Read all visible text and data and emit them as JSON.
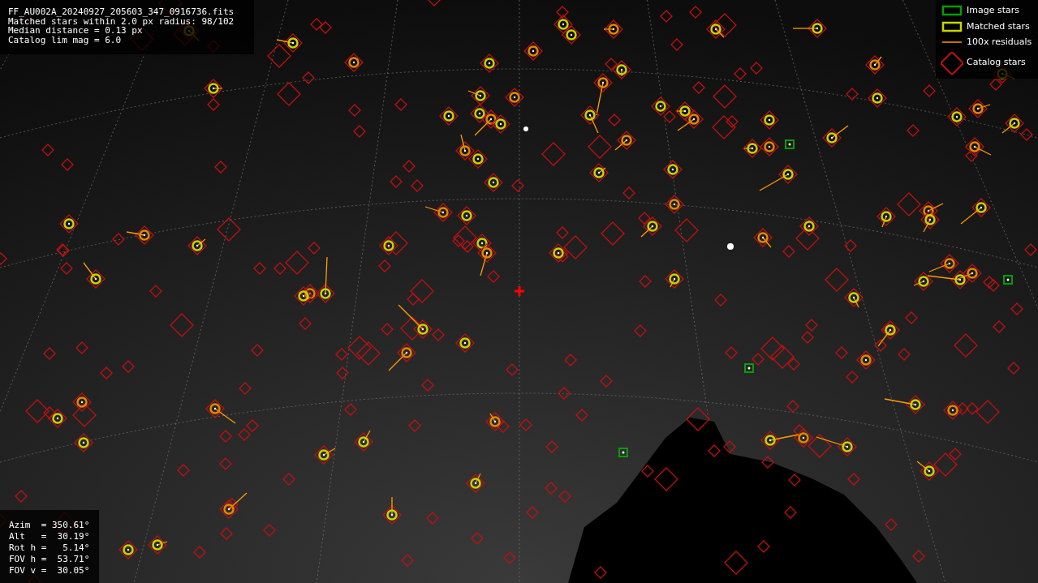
{
  "info_lines": [
    "FF_AU002A_20240927_205603_347_0916736.fits",
    "Matched stars within 2.0 px radius: 98/102",
    "Median distance = 0.13 px",
    "Catalog lim mag = 6.0"
  ],
  "legend": [
    {
      "kind": "image",
      "label": "Image stars"
    },
    {
      "kind": "matched",
      "label": "Matched stars"
    },
    {
      "kind": "residual",
      "label": "100x residuals"
    },
    {
      "kind": "catalog",
      "label": "Catalog stars"
    }
  ],
  "pointing": [
    "Azim  = 350.61°",
    "Alt   =  30.19°",
    "Rot h =   5.14°",
    "FOV h =  53.71°",
    "FOV v =  30.05°"
  ]
}
